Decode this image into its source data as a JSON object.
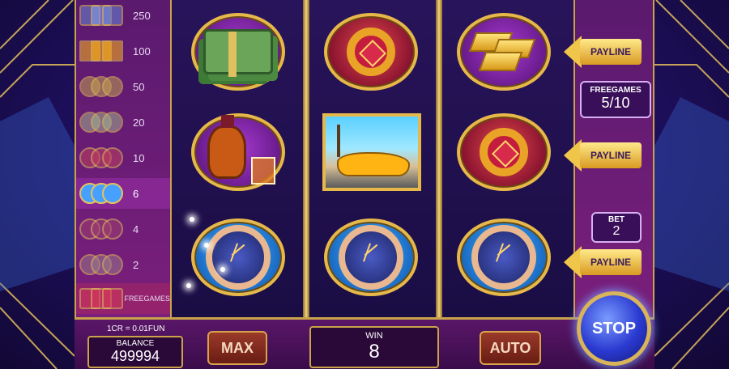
{
  "paytable": [
    {
      "value": "250",
      "symbol": "diamonds-icon"
    },
    {
      "value": "100",
      "symbol": "sports-car-icon"
    },
    {
      "value": "50",
      "symbol": "gold-bars-icon"
    },
    {
      "value": "20",
      "symbol": "cash-stack-icon"
    },
    {
      "value": "10",
      "symbol": "ring-icon"
    },
    {
      "value": "6",
      "symbol": "watch-icon"
    },
    {
      "value": "4",
      "symbol": "cognac-icon"
    },
    {
      "value": "2",
      "symbol": "bar-icon"
    },
    {
      "value": "FREEGAMES",
      "symbol": "bonus-icon"
    }
  ],
  "paytable_highlight_index": 5,
  "reels": [
    [
      "cash-stack-icon",
      "cognac-icon",
      "watch-icon"
    ],
    [
      "ring-icon",
      "sports-car-icon",
      "watch-icon"
    ],
    [
      "gold-bars-icon",
      "ring-icon",
      "watch-icon"
    ]
  ],
  "paylines": [
    {
      "label": "PAYLINE"
    },
    {
      "label": "PAYLINE"
    },
    {
      "label": "PAYLINE"
    }
  ],
  "freegames": {
    "label": "FREEGAMES",
    "value": "5/10"
  },
  "bet": {
    "label": "BET",
    "value": "2"
  },
  "bottom": {
    "rate": "1CR = 0.01FUN",
    "balance_label": "BALANCE",
    "balance_value": "499994",
    "max_label": "MAX",
    "win_label": "WIN",
    "win_value": "8",
    "auto_label": "AUTO",
    "stop_label": "STOP"
  },
  "colors": {
    "gold": "#e6b84a",
    "purple_panel": "#7a1f7c",
    "stop_blue": "#2a3ad0"
  }
}
